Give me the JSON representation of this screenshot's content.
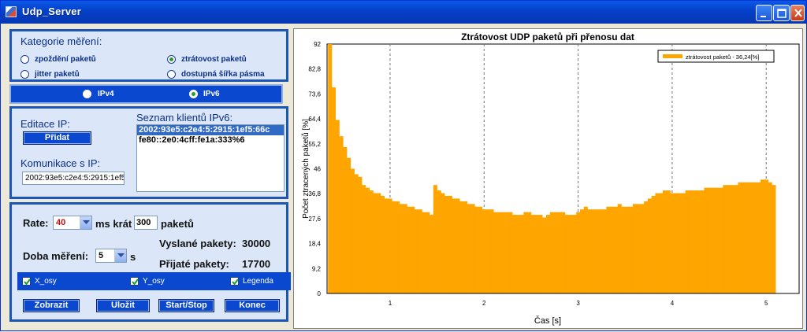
{
  "window": {
    "title": "Udp_Server"
  },
  "category": {
    "heading": "Kategorie měření:",
    "options": [
      {
        "label": "zpoždění paketů",
        "selected": false
      },
      {
        "label": "ztrátovost paketů",
        "selected": true
      },
      {
        "label": "jitter paketů",
        "selected": false
      },
      {
        "label": "dostupná šířka pásma",
        "selected": false
      }
    ]
  },
  "ip_version": {
    "options": [
      {
        "label": "IPv4",
        "selected": false
      },
      {
        "label": "IPv6",
        "selected": true
      }
    ]
  },
  "ip_edit": {
    "heading": "Editace IP:",
    "add_button": "Přidat",
    "comm_label": "Komunikace s IP:",
    "comm_value": "2002:93e5:c2e4:5:2915:1ef5",
    "clients_heading": "Seznam klientů IPv6:",
    "clients": [
      "2002:93e5:c2e4:5:2915:1ef5:66c",
      "fe80::2e0:4cff:fe1a:333%6"
    ]
  },
  "settings": {
    "rate_label": "Rate:",
    "rate_value": "40",
    "rate_unit": "ms krát",
    "packets_value": "300",
    "packets_unit": "paketů",
    "duration_label": "Doba měření:",
    "duration_value": "5",
    "duration_unit": "s",
    "sent_label": "Vyslané pakety:",
    "sent_value": "30000",
    "received_label": "Přijaté pakety:",
    "received_value": "17700"
  },
  "checkboxes": [
    {
      "label": "X_osy",
      "checked": true
    },
    {
      "label": "Y_osy",
      "checked": true
    },
    {
      "label": "Legenda",
      "checked": true
    }
  ],
  "buttons": {
    "show": "Zobrazit",
    "save": "Uložit",
    "startstop": "Start/Stop",
    "end": "Konec"
  },
  "colors": {
    "panel_border": "#1a55b7",
    "panel_bg": "#dbe7f9",
    "button_bg": "#0a48d0",
    "series": "#ffa500"
  },
  "chart_data": {
    "type": "bar",
    "title": "Ztrátovost UDP paketů při přenosu dat",
    "xlabel": "Čas [s]",
    "ylabel": "Počet ztracených paketů [%]",
    "ylim": [
      0,
      92
    ],
    "xlim": [
      0.33,
      5.35
    ],
    "y_ticks": [
      "0",
      "9,2",
      "18,4",
      "27,6",
      "36,8",
      "46",
      "55,2",
      "64,4",
      "73,6",
      "82,8",
      "92"
    ],
    "x_ticks": [
      "1",
      "2",
      "3",
      "4",
      "5"
    ],
    "grid": true,
    "legend_position": "top-right",
    "series": [
      {
        "name": "ztrátovost paketů - 36,24[%]",
        "color": "#ffa500",
        "x": [
          0.36,
          0.4,
          0.44,
          0.48,
          0.52,
          0.56,
          0.6,
          0.64,
          0.68,
          0.72,
          0.76,
          0.8,
          0.84,
          0.88,
          0.92,
          0.96,
          1.0,
          1.04,
          1.08,
          1.12,
          1.16,
          1.2,
          1.24,
          1.28,
          1.32,
          1.36,
          1.4,
          1.44,
          1.48,
          1.52,
          1.56,
          1.6,
          1.64,
          1.68,
          1.72,
          1.76,
          1.8,
          1.84,
          1.88,
          1.92,
          1.96,
          2.0,
          2.04,
          2.08,
          2.12,
          2.16,
          2.2,
          2.24,
          2.28,
          2.32,
          2.36,
          2.4,
          2.44,
          2.48,
          2.52,
          2.56,
          2.6,
          2.64,
          2.68,
          2.72,
          2.76,
          2.8,
          2.84,
          2.88,
          2.92,
          2.96,
          3.0,
          3.04,
          3.08,
          3.12,
          3.16,
          3.2,
          3.24,
          3.28,
          3.32,
          3.36,
          3.4,
          3.44,
          3.48,
          3.52,
          3.56,
          3.6,
          3.64,
          3.68,
          3.72,
          3.76,
          3.8,
          3.84,
          3.88,
          3.92,
          3.96,
          4.0,
          4.04,
          4.08,
          4.12,
          4.16,
          4.2,
          4.24,
          4.28,
          4.32,
          4.36,
          4.4,
          4.44,
          4.48,
          4.52,
          4.56,
          4.6,
          4.64,
          4.68,
          4.72,
          4.76,
          4.8,
          4.84,
          4.88,
          4.92,
          4.96,
          5.0,
          5.04,
          5.08
        ],
        "values": [
          92,
          76,
          64,
          58,
          54,
          50,
          46,
          44,
          43,
          40,
          39,
          38,
          37,
          37,
          36,
          35,
          35,
          34,
          34,
          33,
          33,
          32,
          32,
          31,
          31,
          30,
          30,
          29,
          40,
          38,
          37,
          36,
          36,
          35,
          35,
          34,
          34,
          33,
          33,
          32,
          32,
          31,
          31,
          31,
          30,
          30,
          30,
          30,
          30,
          29,
          29,
          29,
          30,
          30,
          29,
          29,
          29,
          28,
          29,
          30,
          30,
          30,
          30,
          29,
          29,
          29,
          30,
          31,
          32,
          31,
          31,
          31,
          31,
          31,
          32,
          32,
          32,
          33,
          32,
          32,
          32,
          33,
          33,
          33,
          34,
          35,
          36,
          37,
          37,
          38,
          38,
          37,
          37,
          37,
          37,
          38,
          38,
          38,
          38,
          38,
          39,
          39,
          39,
          39,
          39,
          40,
          40,
          40,
          40,
          41,
          41,
          41,
          41,
          41,
          41,
          42,
          42,
          41,
          40
        ]
      }
    ]
  }
}
